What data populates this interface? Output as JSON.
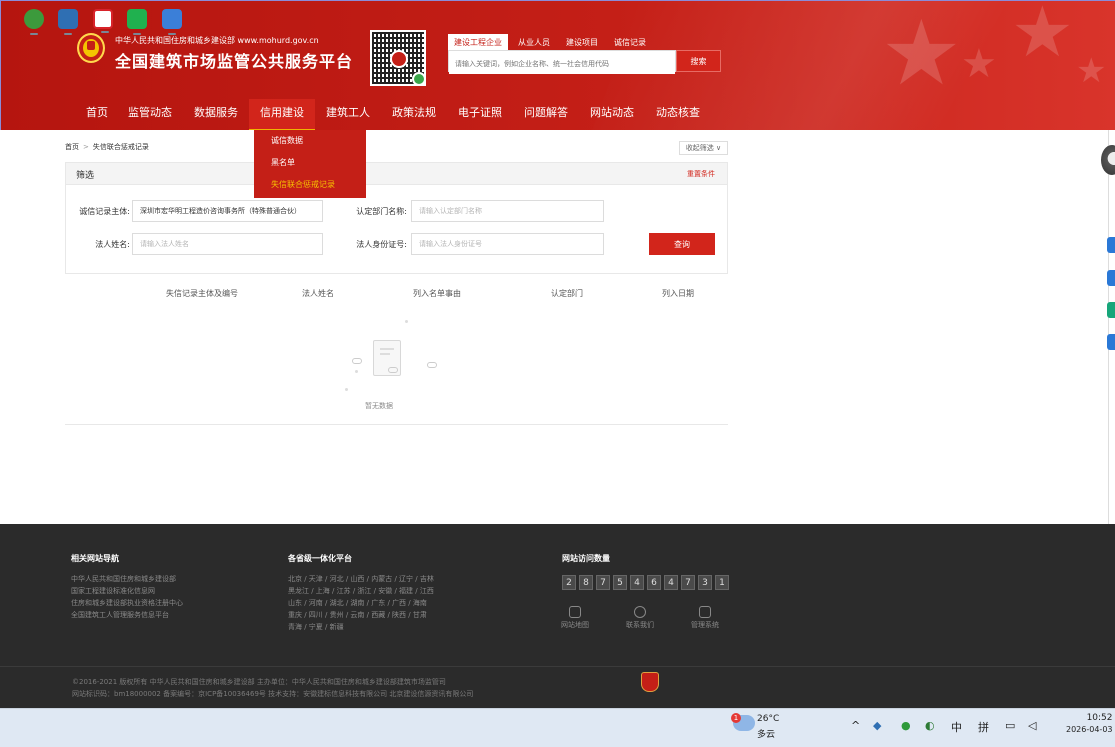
{
  "header": {
    "ministry": "中华人民共和国住房和城乡建设部  www.mohurd.gov.cn",
    "platform_title": "全国建筑市场监管公共服务平台",
    "search_tabs": [
      "建设工程企业",
      "从业人员",
      "建设项目",
      "诚信记录"
    ],
    "search_placeholder": "请输入关键词，例如企业名称、统一社会信用代码",
    "search_button": "搜索"
  },
  "nav": {
    "items": [
      "首页",
      "监管动态",
      "数据服务",
      "信用建设",
      "建筑工人",
      "政策法规",
      "电子证照",
      "问题解答",
      "网站动态",
      "动态核查"
    ],
    "active": "信用建设"
  },
  "dropdown": {
    "items": [
      "诚信数据",
      "黑名单",
      "失信联合惩戒记录"
    ],
    "highlighted": "失信联合惩戒记录"
  },
  "breadcrumb": {
    "home": "首页",
    "separator": ">",
    "current": "失信联合惩戒记录"
  },
  "collapse_filter": "收起筛选 ∨",
  "filter": {
    "title": "筛选",
    "reset": "重置条件",
    "subject_label": "诚信记录主体:",
    "subject_value": "深圳市宏华明工程造价咨询事务所（特殊普通合伙）",
    "dept_label": "认定部门名称:",
    "dept_placeholder": "请输入认定部门名称",
    "legal_name_label": "法人姓名:",
    "legal_name_placeholder": "请输入法人姓名",
    "legal_id_label": "法人身份证号:",
    "legal_id_placeholder": "请输入法人身份证号",
    "query_button": "查询"
  },
  "table": {
    "columns": [
      "失信记录主体及编号",
      "法人姓名",
      "列入名单事由",
      "认定部门",
      "列入日期"
    ],
    "empty_text": "暂无数据"
  },
  "footer": {
    "links_title": "相关网站导航",
    "links": [
      "中华人民共和国住房和城乡建设部",
      "国家工程建设标准化信息网",
      "住房和城乡建设部执业资格注册中心",
      "全国建筑工人管理服务信息平台"
    ],
    "provinces_title": "各省级一体化平台",
    "provinces": [
      "北京 / 天津 / 河北 / 山西 / 内蒙古 / 辽宁 / 吉林",
      "黑龙江 / 上海 / 江苏 / 浙江 / 安徽 / 福建 / 江西",
      "山东 / 河南 / 湖北 / 湖南 / 广东 / 广西 / 海南",
      "重庆 / 四川 / 贵州 / 云南 / 西藏 / 陕西 / 甘肃",
      "青海 / 宁夏 / 新疆"
    ],
    "visits_title": "网站访问数量",
    "visit_digits": [
      "2",
      "8",
      "7",
      "5",
      "4",
      "6",
      "4",
      "7",
      "3",
      "1"
    ],
    "icons": [
      {
        "label": "网站地图",
        "icon": "sitemap-icon"
      },
      {
        "label": "联系我们",
        "icon": "chat-icon"
      },
      {
        "label": "管理系统",
        "icon": "monitor-icon"
      }
    ],
    "copyright": "©2016-2021 版权所有 中华人民共和国住房和城乡建设部  主办单位：中华人民共和国住房和城乡建设部建筑市场监管司",
    "icp": "网站标识码：bm18000002  备案编号：京ICP备10036469号  技术支持：安徽建标信息科技有限公司 北京建设信源资讯有限公司"
  },
  "taskbar": {
    "weather_temp": "26°C",
    "weather_desc": "多云",
    "weather_badge": "1",
    "tray": [
      "^",
      "中",
      "拼"
    ],
    "time": "10:52",
    "date": "2026-04-03"
  },
  "colors": {
    "brand_red": "#c41f17",
    "accent_red": "#d2251b",
    "footer_bg": "#2b2b2b",
    "highlight_yellow": "#f6c200"
  }
}
